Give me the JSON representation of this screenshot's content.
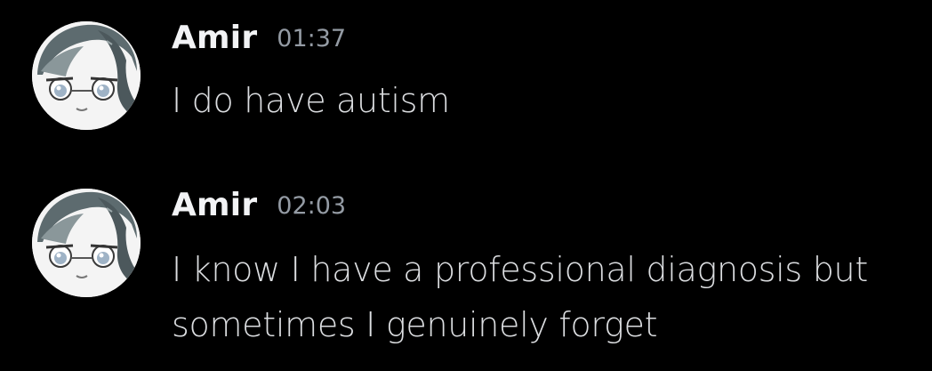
{
  "colors": {
    "background": "#000000",
    "username": "#f2f3f5",
    "timestamp": "#949ba4",
    "message_text": "#dcdee1"
  },
  "messages": [
    {
      "author": "Amir",
      "timestamp": "01:37",
      "text": "I do have autism",
      "avatar_icon": "anime-avatar-icon"
    },
    {
      "author": "Amir",
      "timestamp": "02:03",
      "text": "I know I have a professional diagnosis but sometimes I genuinely forget",
      "avatar_icon": "anime-avatar-icon"
    }
  ]
}
